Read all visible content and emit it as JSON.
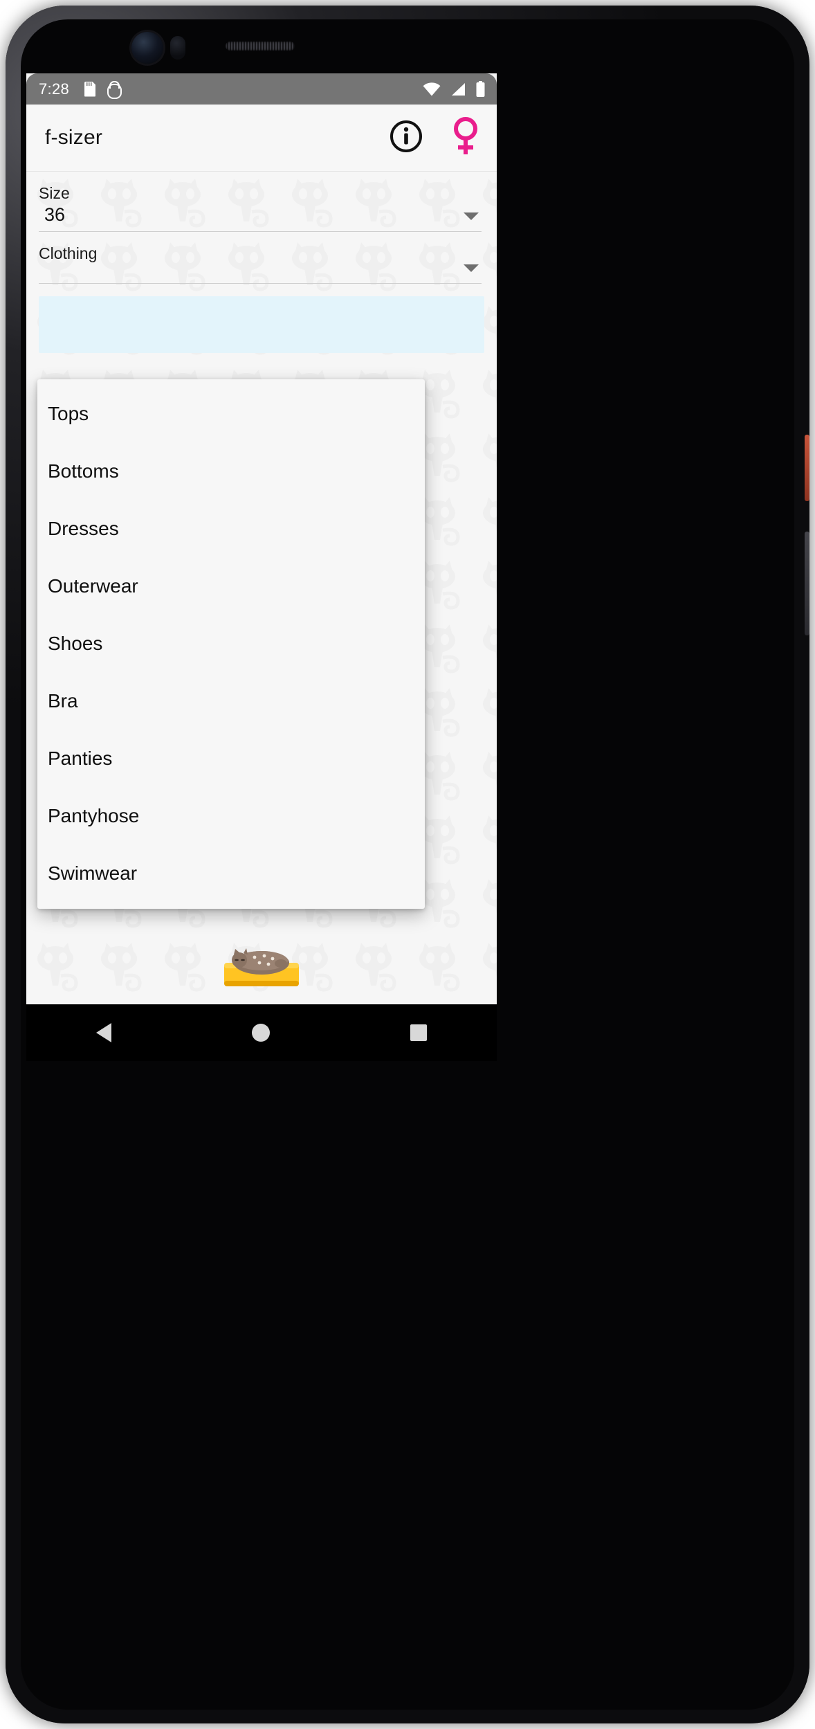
{
  "device": {
    "camera_icon": "camera-lens-icon",
    "speaker_icon": "earpiece-speaker-icon"
  },
  "status_bar": {
    "time": "7:28",
    "left_icons": [
      {
        "name": "sd-card-icon"
      },
      {
        "name": "android-debug-bug-icon"
      }
    ],
    "right_icons": [
      {
        "name": "wifi-icon"
      },
      {
        "name": "cellular-signal-icon"
      },
      {
        "name": "battery-full-icon"
      }
    ],
    "background_color": "#757575"
  },
  "app_bar": {
    "title": "f-sizer",
    "actions": [
      {
        "name": "info-icon",
        "label": "Info",
        "color": "#000000"
      },
      {
        "name": "female-gender-icon",
        "label": "Female",
        "color": "#E91E8C"
      }
    ],
    "background_color": "#f7f7f7"
  },
  "form": {
    "size_field": {
      "label": "Size",
      "value": "36",
      "caret_icon": "chevron-down-icon"
    },
    "clothing_field": {
      "label": "Clothing",
      "value": "",
      "caret_icon": "chevron-down-icon"
    }
  },
  "result_card": {
    "text": "",
    "background_color": "#e3f4fb"
  },
  "dropdown": {
    "open": true,
    "items": [
      {
        "label": "Tops"
      },
      {
        "label": "Bottoms"
      },
      {
        "label": "Dresses"
      },
      {
        "label": "Outerwear"
      },
      {
        "label": "Shoes"
      },
      {
        "label": "Bra"
      },
      {
        "label": "Panties"
      },
      {
        "label": "Pantyhose"
      },
      {
        "label": "Swimwear"
      }
    ]
  },
  "background": {
    "watermark_icon": "cat-watermark-icon",
    "watermark_color": "#efefef",
    "mascot_icon": "sleeping-cat-on-cushion-icon",
    "mascot_cushion_color": "#FFC422"
  },
  "nav_bar": {
    "buttons": [
      {
        "name": "nav-back-button",
        "icon": "triangle-back-icon"
      },
      {
        "name": "nav-home-button",
        "icon": "circle-home-icon"
      },
      {
        "name": "nav-recents-button",
        "icon": "square-recents-icon"
      }
    ],
    "background_color": "#000000"
  }
}
